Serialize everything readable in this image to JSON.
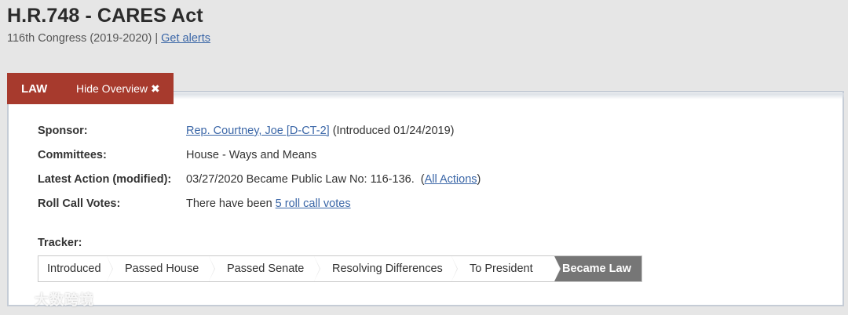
{
  "bill": {
    "title": "H.R.748 - CARES Act",
    "congress": "116th Congress (2019-2020) |",
    "alerts_link": "Get alerts"
  },
  "tabbar": {
    "status": "LAW",
    "hide_overview": "Hide Overview"
  },
  "overview": {
    "sponsor": {
      "label": "Sponsor:",
      "link": "Rep. Courtney, Joe [D-CT-2]",
      "suffix": " (Introduced 01/24/2019)"
    },
    "committees": {
      "label": "Committees:",
      "value": "House - Ways and Means"
    },
    "latest_action": {
      "label": "Latest Action (modified):",
      "value": "03/27/2020 Became Public Law No: 116-136.  (",
      "link": "All Actions",
      "suffix": ")"
    },
    "roll_call": {
      "label": "Roll Call Votes:",
      "prefix": "There have been ",
      "link": "5 roll call votes"
    }
  },
  "tracker": {
    "label": "Tracker:",
    "steps": [
      "Introduced",
      "Passed House",
      "Passed Senate",
      "Resolving Differences",
      "To President",
      "Became Law"
    ],
    "current_index": 5
  },
  "watermark": {
    "text": "大数跨境"
  },
  "colors": {
    "accent_red": "#a73a2d",
    "link_blue": "#3a66a7",
    "current_step": "#767676"
  }
}
